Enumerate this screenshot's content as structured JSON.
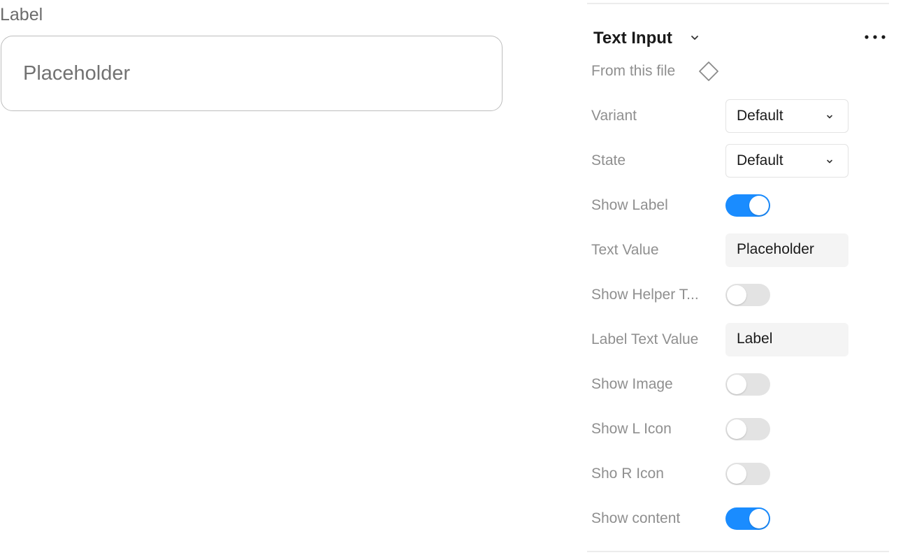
{
  "preview": {
    "label": "Label",
    "placeholder": "Placeholder"
  },
  "panel": {
    "title": "Text Input",
    "source": "From this file",
    "accent_color": "#1a8cff",
    "properties": [
      {
        "label": "Variant",
        "type": "select",
        "value": "Default"
      },
      {
        "label": "State",
        "type": "select",
        "value": "Default"
      },
      {
        "label": "Show Label",
        "type": "toggle",
        "on": true
      },
      {
        "label": "Text Value",
        "type": "text",
        "value": "Placeholder"
      },
      {
        "label": "Show Helper T...",
        "type": "toggle",
        "on": false
      },
      {
        "label": "Label Text Value",
        "type": "text",
        "value": "Label"
      },
      {
        "label": "Show Image",
        "type": "toggle",
        "on": false
      },
      {
        "label": "Show L Icon",
        "type": "toggle",
        "on": false
      },
      {
        "label": "Sho R Icon",
        "type": "toggle",
        "on": false
      },
      {
        "label": "Show content",
        "type": "toggle",
        "on": true
      }
    ]
  }
}
